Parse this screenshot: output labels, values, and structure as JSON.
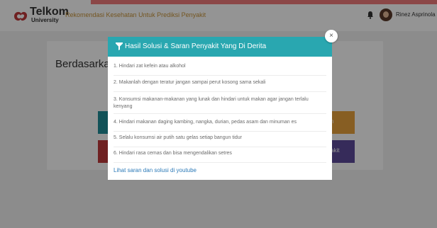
{
  "header": {
    "logo_word": "Telkom",
    "logo_sub": "University",
    "app_title": "Rekomendasi Kesehatan Untuk Prediksi Penyakit",
    "username": "Rinez Asprinola"
  },
  "colors": {
    "accent": "#f07b7b",
    "modal_header": "#29a7b0",
    "title_text": "#c8943a",
    "link": "#2c7ab8"
  },
  "page": {
    "heading": "Berdasarka",
    "tile_orange_label": "n",
    "tile_purple_label": "akit"
  },
  "modal": {
    "title": "Hasil Solusi & Saran Penyakit Yang Di Derita",
    "close_label": "×",
    "suggestions": [
      "1. Hindari zat kefein atau alkohol",
      "2. Makanlah dengan teratur jangan sampai perut kosong sama sekali",
      "3. Konsumsi makanan-makanan yang lunak dan hindari untuk makan agar jangan terlalu kenyang",
      "4. Hindari makanan daging kambing, nangka, durian, pedas asam dan minuman es",
      "5. Selalu konsumsi air putih satu gelas setiap bangun tidur",
      "6. Hindari rasa cemas dan bisa mengendalikan setres"
    ],
    "link_label": "Lihat saran dan solusi di youtube"
  }
}
